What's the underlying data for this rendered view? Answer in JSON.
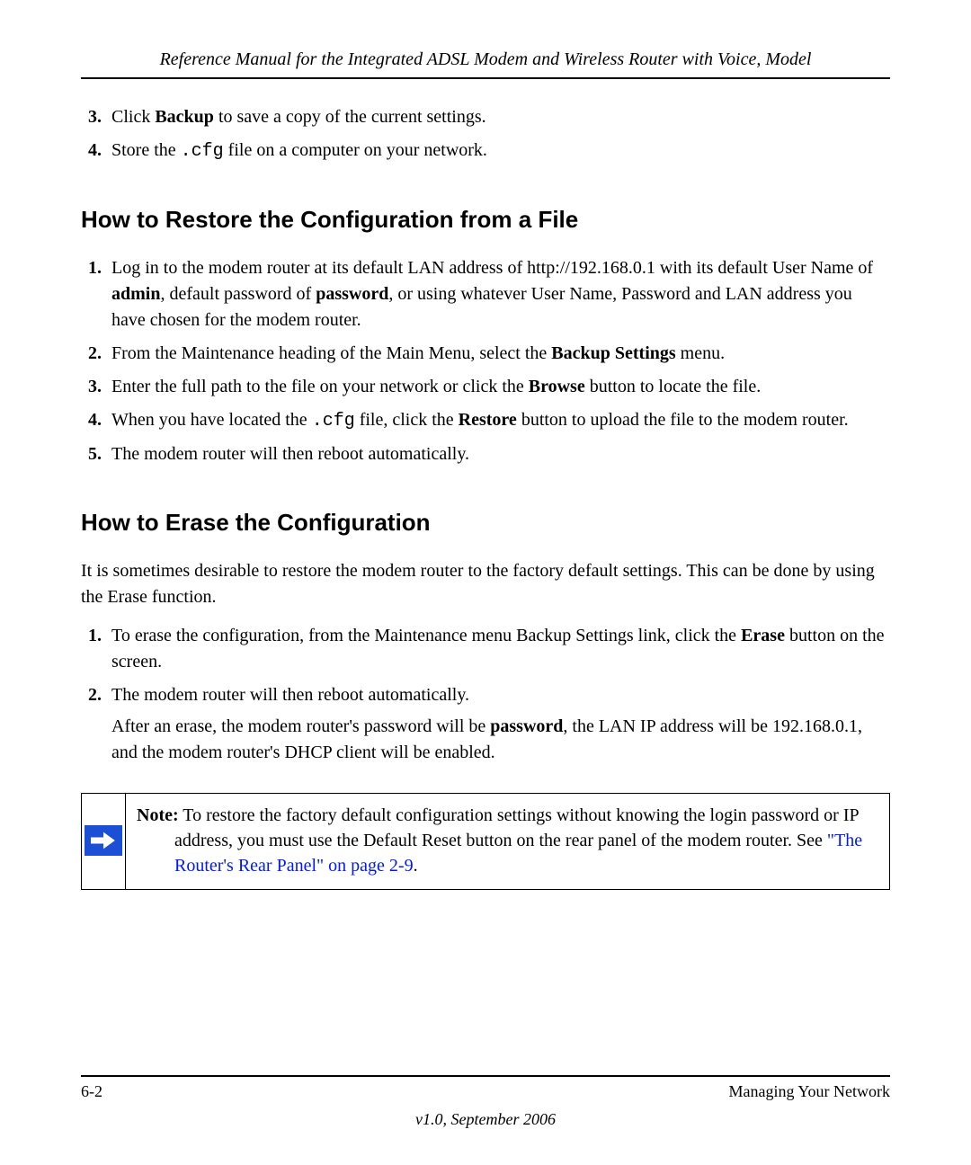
{
  "header": {
    "title": "Reference Manual for the Integrated ADSL Modem and Wireless Router with Voice, Model"
  },
  "top_list": {
    "start": 3,
    "items": [
      {
        "pre": "Click ",
        "bold": "Backup",
        "post": " to save a copy of the current settings."
      },
      {
        "pre": "Store the ",
        "mono": ".cfg",
        "post": " file on a computer on your network."
      }
    ]
  },
  "section_restore": {
    "heading": "How to Restore the Configuration from a File",
    "items": [
      {
        "parts": [
          {
            "t": "Log in to the modem router at its default LAN address of http://192.168.0.1 with its default User Name of "
          },
          {
            "t": "admin",
            "b": true
          },
          {
            "t": ", default password of "
          },
          {
            "t": "password",
            "b": true
          },
          {
            "t": ", or using whatever User Name, Password and LAN address you have chosen for the modem router."
          }
        ]
      },
      {
        "parts": [
          {
            "t": "From the Maintenance heading of the Main Menu, select the "
          },
          {
            "t": "Backup Settings",
            "b": true
          },
          {
            "t": " menu."
          }
        ]
      },
      {
        "parts": [
          {
            "t": "Enter the full path to the file on your network or click the "
          },
          {
            "t": "Browse",
            "b": true
          },
          {
            "t": " button to locate the file."
          }
        ]
      },
      {
        "parts": [
          {
            "t": "When you have located the "
          },
          {
            "t": ".cfg",
            "mono": true
          },
          {
            "t": " file, click the "
          },
          {
            "t": "Restore",
            "b": true
          },
          {
            "t": " button to upload the file to the modem router."
          }
        ]
      },
      {
        "parts": [
          {
            "t": "The modem router will then reboot automatically."
          }
        ]
      }
    ]
  },
  "section_erase": {
    "heading": "How to Erase the Configuration",
    "intro": "It is sometimes desirable to restore the modem router to the factory default settings. This can be done by using the Erase function.",
    "items": [
      {
        "parts": [
          {
            "t": "To erase the configuration, from the Maintenance menu Backup Settings link, click the "
          },
          {
            "t": "Erase",
            "b": true
          },
          {
            "t": " button on the screen."
          }
        ]
      },
      {
        "parts": [
          {
            "t": "The modem router will then reboot automatically."
          }
        ],
        "after_parts": [
          {
            "t": "After an erase, the modem router's password will be "
          },
          {
            "t": "password",
            "b": true
          },
          {
            "t": ", the LAN IP address will be 192.168.0.1, and the modem router's DHCP client will be enabled."
          }
        ]
      }
    ]
  },
  "note": {
    "label": "Note:",
    "text_before_link": " To restore the factory default configuration settings without knowing the login password or IP address, you must use the Default Reset button on the rear panel of the modem router. See ",
    "link_text": "\"The Router's Rear Panel\" on page 2-9",
    "text_after_link": "."
  },
  "footer": {
    "page": "6-2",
    "chapter": "Managing Your Network",
    "version": "v1.0, September 2006"
  }
}
